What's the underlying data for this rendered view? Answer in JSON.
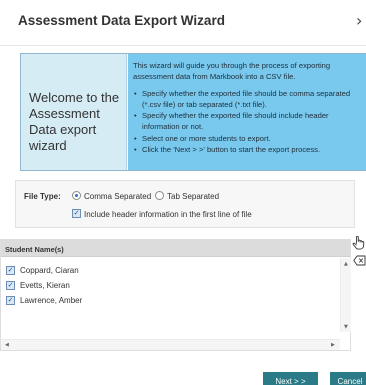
{
  "dialog": {
    "title": "Assessment Data Export Wizard",
    "close_glyph": "›"
  },
  "banner": {
    "welcome": "Welcome to the Assessment Data export wizard",
    "intro": "This wizard will guide you through the process of exporting assessment data from Markbook into a CSV file.",
    "bullets": [
      "Specify whether the exported file should be comma separated (*.csv file) or tab separated (*.txt file).",
      "Specify whether the exported file should include header information or not.",
      "Select one or more students to export.",
      "Click the 'Next > >' button to start the export process."
    ]
  },
  "file_type": {
    "label": "File Type:",
    "options": [
      {
        "label": "Comma Separated",
        "selected": true
      },
      {
        "label": "Tab Separated",
        "selected": false
      }
    ],
    "include_header": {
      "label": "Include header information in the first line of file",
      "checked": true
    }
  },
  "students": {
    "column_header": "Student Name(s)",
    "rows": [
      {
        "name": "Coppard, Ciaran",
        "checked": true
      },
      {
        "name": "Evetts, Kieran",
        "checked": true
      },
      {
        "name": "Lawrence, Amber",
        "checked": true
      }
    ]
  },
  "icons": {
    "hand": "hand-pointer-icon",
    "clear": "clear-backspace-icon"
  },
  "buttons": {
    "next": "Next > >",
    "cancel": "Cancel"
  },
  "colors": {
    "banner_blue": "#79c9ee",
    "banner_light": "#d6ecf5",
    "button_teal": "#2a7a87",
    "radio_selected": "#2c6fc0"
  }
}
